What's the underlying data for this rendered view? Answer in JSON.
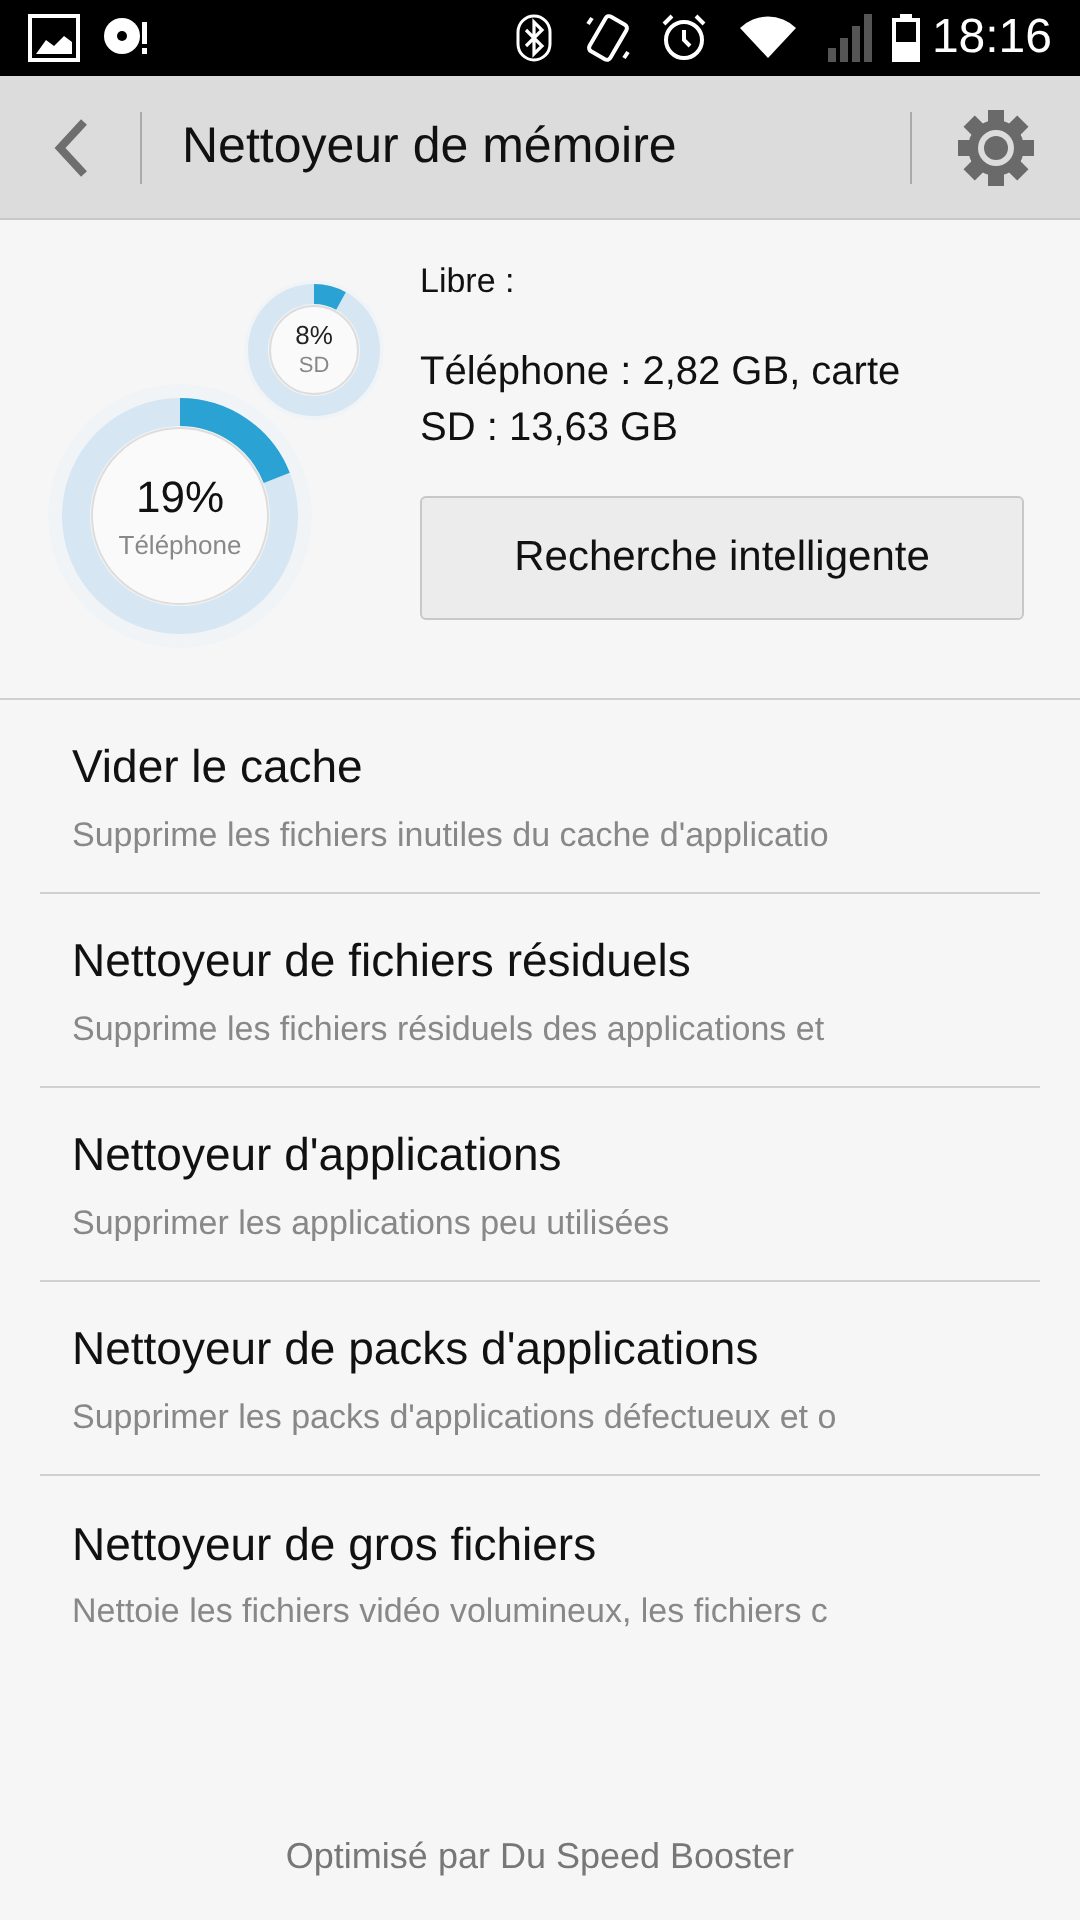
{
  "status_bar": {
    "time": "18:16"
  },
  "header": {
    "title": "Nettoyeur de mémoire"
  },
  "storage": {
    "phone": {
      "reading": "19%",
      "label": "Téléphone",
      "level": 0.19
    },
    "sd": {
      "reading": "8%",
      "label": "SD",
      "level": 0.08
    },
    "free_label": "Libre :",
    "free_text": "Téléphone : 2,82 GB, carte SD : 13,63 GB",
    "button": "Recherche intelligente"
  },
  "items": [
    {
      "title": "Vider le cache",
      "subtitle": "Supprime les fichiers inutiles du cache d'applicatio"
    },
    {
      "title": "Nettoyeur de fichiers résiduels",
      "subtitle": "Supprime les fichiers résiduels des applications et"
    },
    {
      "title": "Nettoyeur d'applications",
      "subtitle": "Supprimer les applications peu utilisées"
    },
    {
      "title": "Nettoyeur de packs d'applications",
      "subtitle": "Supprimer les packs d'applications défectueux et o"
    },
    {
      "title": "Nettoyeur de gros fichiers",
      "subtitle": "Nettoie les fichiers vidéo volumineux, les fichiers c"
    }
  ],
  "footer": "Optimisé par Du Speed Booster"
}
